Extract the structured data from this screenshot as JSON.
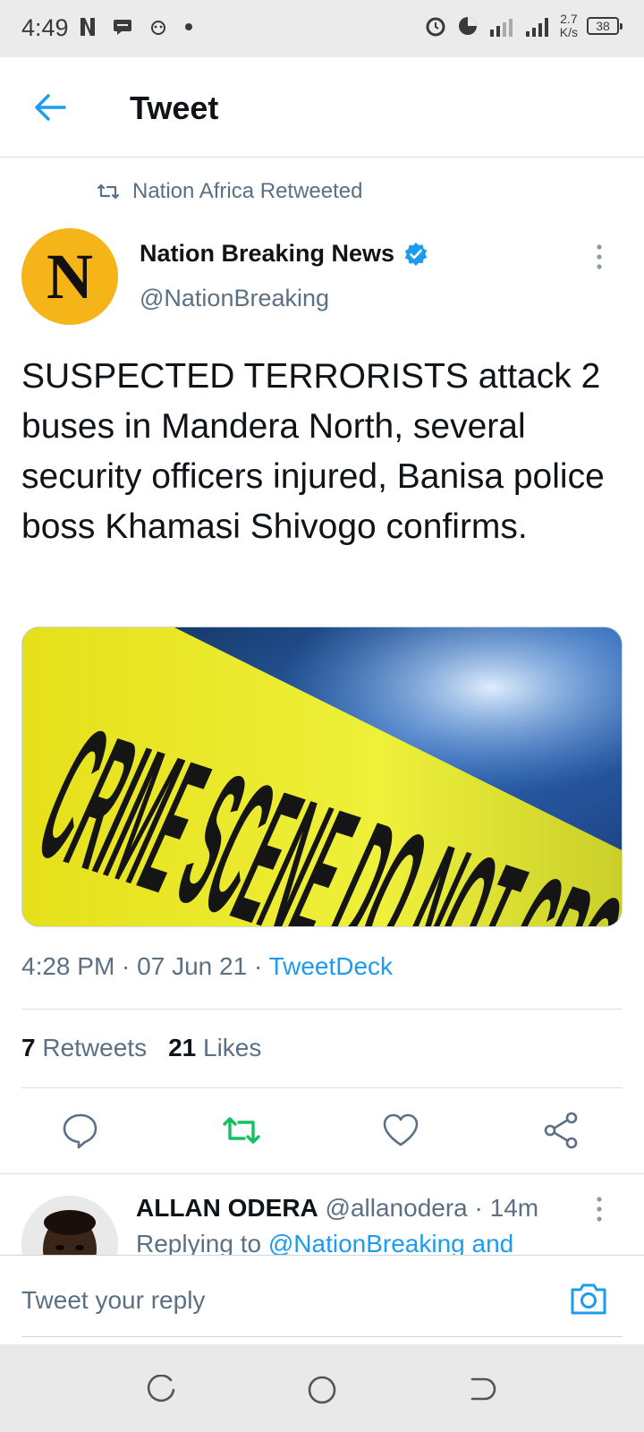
{
  "status_bar": {
    "time": "4:49",
    "net_speed_value": "2.7",
    "net_speed_unit": "K/s",
    "battery": "38"
  },
  "header": {
    "title": "Tweet",
    "back_icon": "arrow-left-icon"
  },
  "tweet": {
    "retweeted_by": "Nation Africa Retweeted",
    "avatar_letter": "N",
    "author_name": "Nation Breaking News",
    "author_handle": "@NationBreaking",
    "verified": true,
    "text": "SUSPECTED TERRORISTS attack 2 buses in Mandera North, several security officers injured, Banisa police boss Khamasi Shivogo confirms.",
    "media_text": "CRIME SCENE DO NOT CROSS",
    "time": "4:28 PM",
    "date": "07 Jun 21",
    "source": "TweetDeck",
    "retweets_count": "7",
    "retweets_label": "Retweets",
    "likes_count": "21",
    "likes_label": "Likes"
  },
  "actions": {
    "reply_icon": "reply-icon",
    "retweet_icon": "retweet-icon",
    "like_icon": "heart-icon",
    "share_icon": "share-icon",
    "retweet_color": "#17bf63"
  },
  "reply": {
    "name": "ALLAN ODERA",
    "handle": "@allanodera",
    "time": "14m",
    "replying_prefix": "Replying to",
    "replying_to": "@NationBreaking and"
  },
  "composer": {
    "placeholder": "Tweet your reply",
    "camera_icon": "camera-icon"
  },
  "colors": {
    "accent": "#1d9bf0",
    "avatar_bg": "#f5b417",
    "secondary_text": "#5b7083"
  }
}
